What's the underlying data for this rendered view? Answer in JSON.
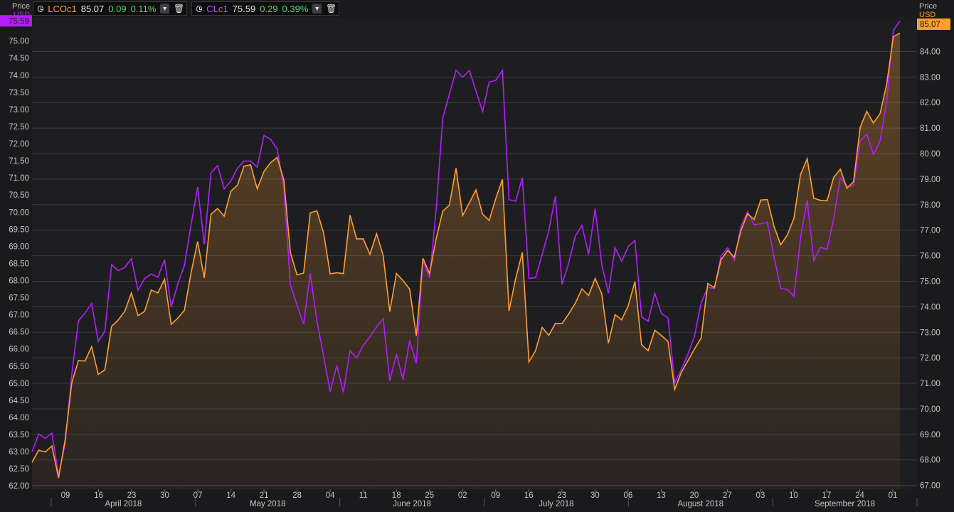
{
  "header": {
    "left_axis": {
      "title": "Price",
      "currency": "USD"
    },
    "right_axis": {
      "title": "Price",
      "currency": "USD"
    },
    "legend": [
      {
        "ric": "LCOc1",
        "last": "85.07",
        "change": "0.09",
        "pct_change": "0.11%",
        "color": "#ff9f2e"
      },
      {
        "ric": "CLc1",
        "last": "75.59",
        "change": "0.29",
        "pct_change": "0.39%",
        "color": "#b51cff"
      }
    ]
  },
  "chart_data": {
    "type": "line",
    "x_labels": [
      "09",
      "16",
      "23",
      "30",
      "07",
      "14",
      "21",
      "28",
      "04",
      "11",
      "18",
      "25",
      "02",
      "09",
      "16",
      "23",
      "30",
      "06",
      "13",
      "20",
      "27",
      "03",
      "10",
      "17",
      "24",
      "01"
    ],
    "month_labels": [
      "April 2018",
      "May 2018",
      "June 2018",
      "July 2018",
      "August 2018",
      "September 2018"
    ],
    "left_axis": {
      "series": "CLc1",
      "ylim": [
        61.9,
        75.7
      ],
      "ticks": [
        "62.00",
        "62.50",
        "63.00",
        "63.50",
        "64.00",
        "64.50",
        "65.00",
        "65.50",
        "66.00",
        "66.50",
        "67.00",
        "67.50",
        "68.00",
        "68.50",
        "69.00",
        "69.50",
        "70.00",
        "70.50",
        "71.00",
        "71.50",
        "72.00",
        "72.50",
        "73.00",
        "73.50",
        "74.00",
        "74.50",
        "75.00"
      ]
    },
    "right_axis": {
      "series": "LCOc1",
      "ylim": [
        66.85,
        85.35
      ],
      "ticks": [
        "67.00",
        "68.00",
        "69.00",
        "70.00",
        "71.00",
        "72.00",
        "73.00",
        "74.00",
        "75.00",
        "76.00",
        "77.00",
        "78.00",
        "79.00",
        "80.00",
        "81.00",
        "82.00",
        "83.00",
        "84.00"
      ]
    },
    "last_labels": {
      "CLc1": "75.59",
      "LCOc1": "85.07"
    },
    "grid": true,
    "series": [
      {
        "name": "CLc1",
        "color": "#b51cff",
        "values": [
          62.99,
          63.51,
          63.39,
          63.54,
          62.32,
          63.24,
          65.26,
          66.82,
          67.05,
          67.33,
          66.22,
          66.52,
          68.47,
          68.29,
          68.38,
          68.64,
          67.71,
          68.06,
          68.19,
          68.1,
          68.61,
          67.22,
          67.9,
          68.44,
          69.62,
          70.73,
          69.06,
          71.14,
          71.36,
          70.68,
          70.91,
          71.28,
          71.49,
          71.49,
          71.31,
          72.24,
          72.13,
          71.84,
          70.73,
          67.88,
          67.28,
          66.73,
          68.21,
          66.81,
          65.81,
          64.75,
          65.52,
          64.73,
          65.95,
          65.74,
          66.1,
          66.36,
          66.64,
          66.89,
          65.07,
          65.85,
          65.1,
          66.25,
          65.58,
          68.58,
          68.08,
          70.08,
          72.76,
          73.45,
          74.15,
          73.94,
          74.14,
          73.54,
          72.94,
          73.8,
          73.85,
          74.14,
          70.36,
          70.32,
          71.01,
          68.06,
          68.08,
          68.76,
          69.46,
          70.47,
          67.89,
          68.52,
          69.3,
          69.61,
          68.76,
          70.1,
          68.46,
          67.63,
          68.96,
          68.56,
          69.0,
          69.17,
          66.94,
          66.81,
          67.63,
          67.04,
          66.9,
          65.01,
          65.4,
          65.85,
          66.38,
          67.35,
          67.8,
          67.77,
          68.72,
          68.96,
          68.59,
          69.58,
          70.01,
          69.63,
          69.66,
          69.7,
          68.69,
          67.77,
          67.74,
          67.54,
          69.25,
          70.35,
          68.59,
          68.97,
          68.91,
          69.82,
          71.0,
          70.76,
          70.76,
          72.08,
          72.28,
          71.68,
          72.08,
          73.25,
          75.3,
          75.59
        ]
      },
      {
        "name": "LCOc1",
        "color": "#ff9f2e",
        "values": [
          67.9,
          68.38,
          68.31,
          68.54,
          67.29,
          68.8,
          71.02,
          71.89,
          71.87,
          72.44,
          71.35,
          71.53,
          73.23,
          73.48,
          73.82,
          74.54,
          73.65,
          73.82,
          74.66,
          74.54,
          75.08,
          73.31,
          73.55,
          73.86,
          75.32,
          76.56,
          75.13,
          77.62,
          77.85,
          77.55,
          78.52,
          78.76,
          79.51,
          79.56,
          78.62,
          79.3,
          79.64,
          79.85,
          78.98,
          76.12,
          75.25,
          75.32,
          77.68,
          77.76,
          76.9,
          75.29,
          75.33,
          75.3,
          77.59,
          76.66,
          76.66,
          76.05,
          76.86,
          76.01,
          73.81,
          75.3,
          75.03,
          74.69,
          72.86,
          75.9,
          75.3,
          76.67,
          77.75,
          77.98,
          79.43,
          77.57,
          78.07,
          78.58,
          77.63,
          77.38,
          78.24,
          78.99,
          73.84,
          75.1,
          76.13,
          71.84,
          72.28,
          73.19,
          72.88,
          73.35,
          73.34,
          73.72,
          74.14,
          74.7,
          74.44,
          75.11,
          74.5,
          72.57,
          73.69,
          73.49,
          74.05,
          74.99,
          72.51,
          72.28,
          73.08,
          72.87,
          72.64,
          70.76,
          71.43,
          71.89,
          72.35,
          72.78,
          74.91,
          74.75,
          75.84,
          76.21,
          75.94,
          76.99,
          77.64,
          77.42,
          78.18,
          78.2,
          77.14,
          76.43,
          76.81,
          77.47,
          79.18,
          79.8,
          78.25,
          78.17,
          78.15,
          79.07,
          79.39,
          78.64,
          78.9,
          81.03,
          81.66,
          81.2,
          81.57,
          82.72,
          84.58,
          84.72
        ]
      }
    ]
  }
}
